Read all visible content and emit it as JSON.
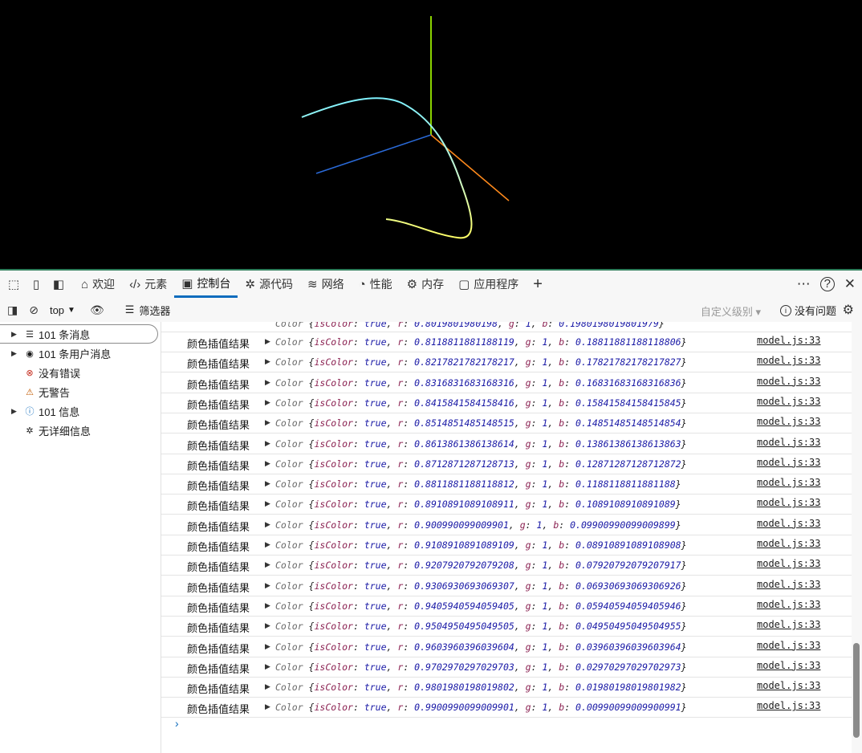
{
  "scene": {
    "axis_colors": {
      "y": "#7acc00",
      "x": "#ff8800",
      "z": "#1f5bd6"
    },
    "curve_colors": [
      "#7ff2ff",
      "#ffff66"
    ]
  },
  "devtools": {
    "accent": "#0f6cbd",
    "tabs": [
      {
        "label": "欢迎",
        "icon": "home-icon"
      },
      {
        "label": "元素",
        "icon": "code-icon"
      },
      {
        "label": "控制台",
        "icon": "console-icon",
        "active": true
      },
      {
        "label": "源代码",
        "icon": "bug-icon"
      },
      {
        "label": "网络",
        "icon": "wifi-icon"
      },
      {
        "label": "性能",
        "icon": "gauge-icon"
      },
      {
        "label": "内存",
        "icon": "chip-icon"
      },
      {
        "label": "应用程序",
        "icon": "app-icon"
      }
    ],
    "toolbar": {
      "context": "top",
      "filter_label": "筛选器",
      "levels": "自定义级别",
      "issues": "没有问题"
    },
    "sidebar": [
      {
        "label": "101 条消息",
        "icon": "list-icon",
        "expandable": true,
        "selected": true
      },
      {
        "label": "101 条用户消息",
        "icon": "user-icon",
        "expandable": true
      },
      {
        "label": "没有错误",
        "icon": "error-icon",
        "expandable": false
      },
      {
        "label": "无警告",
        "icon": "warning-icon",
        "expandable": false
      },
      {
        "label": "101 信息",
        "icon": "info-icon",
        "expandable": true
      },
      {
        "label": "无详细信息",
        "icon": "verbose-icon",
        "expandable": false
      }
    ],
    "console": {
      "partial_top": {
        "r": "0.8019801980198",
        "b": "0.1980198019801979"
      },
      "rows": [
        {
          "label": "颜色插值结果",
          "r": "0.8118811881188119",
          "g": "1",
          "b": "0.18811881188118806",
          "src": "model.js:33"
        },
        {
          "label": "颜色插值结果",
          "r": "0.8217821782178217",
          "g": "1",
          "b": "0.17821782178217827",
          "src": "model.js:33"
        },
        {
          "label": "颜色插值结果",
          "r": "0.8316831683168316",
          "g": "1",
          "b": "0.16831683168316836",
          "src": "model.js:33"
        },
        {
          "label": "颜色插值结果",
          "r": "0.8415841584158416",
          "g": "1",
          "b": "0.15841584158415845",
          "src": "model.js:33"
        },
        {
          "label": "颜色插值结果",
          "r": "0.8514851485148515",
          "g": "1",
          "b": "0.14851485148514854",
          "src": "model.js:33"
        },
        {
          "label": "颜色插值结果",
          "r": "0.8613861386138614",
          "g": "1",
          "b": "0.13861386138613863",
          "src": "model.js:33"
        },
        {
          "label": "颜色插值结果",
          "r": "0.8712871287128713",
          "g": "1",
          "b": "0.12871287128712872",
          "src": "model.js:33"
        },
        {
          "label": "颜色插值结果",
          "r": "0.8811881188118812",
          "g": "1",
          "b": "0.1188118811881188",
          "src": "model.js:33"
        },
        {
          "label": "颜色插值结果",
          "r": "0.8910891089108911",
          "g": "1",
          "b": "0.1089108910891089",
          "src": "model.js:33"
        },
        {
          "label": "颜色插值结果",
          "r": "0.900990099009901",
          "g": "1",
          "b": "0.09900990099009899",
          "src": "model.js:33"
        },
        {
          "label": "颜色插值结果",
          "r": "0.9108910891089109",
          "g": "1",
          "b": "0.08910891089108908",
          "src": "model.js:33"
        },
        {
          "label": "颜色插值结果",
          "r": "0.9207920792079208",
          "g": "1",
          "b": "0.07920792079207917",
          "src": "model.js:33"
        },
        {
          "label": "颜色插值结果",
          "r": "0.9306930693069307",
          "g": "1",
          "b": "0.06930693069306926",
          "src": "model.js:33"
        },
        {
          "label": "颜色插值结果",
          "r": "0.9405940594059405",
          "g": "1",
          "b": "0.05940594059405946",
          "src": "model.js:33"
        },
        {
          "label": "颜色插值结果",
          "r": "0.9504950495049505",
          "g": "1",
          "b": "0.04950495049504955",
          "src": "model.js:33"
        },
        {
          "label": "颜色插值结果",
          "r": "0.9603960396039604",
          "g": "1",
          "b": "0.03960396039603964",
          "src": "model.js:33"
        },
        {
          "label": "颜色插值结果",
          "r": "0.9702970297029703",
          "g": "1",
          "b": "0.02970297029702973",
          "src": "model.js:33"
        },
        {
          "label": "颜色插值结果",
          "r": "0.9801980198019802",
          "g": "1",
          "b": "0.01980198019801982",
          "src": "model.js:33"
        },
        {
          "label": "颜色插值结果",
          "r": "0.9900990099009901",
          "g": "1",
          "b": "0.00990099009900991",
          "src": "model.js:33"
        }
      ],
      "obj_class": "Color",
      "key_iscolor": "isColor",
      "val_true": "true"
    }
  }
}
